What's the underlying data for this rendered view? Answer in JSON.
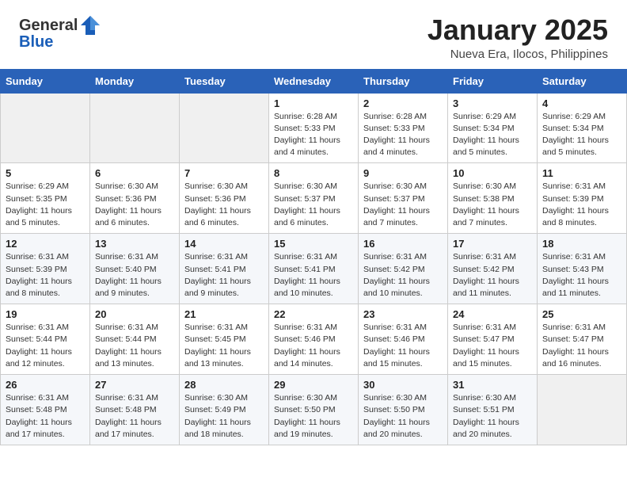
{
  "header": {
    "logo_general": "General",
    "logo_blue": "Blue",
    "month": "January 2025",
    "location": "Nueva Era, Ilocos, Philippines"
  },
  "days_of_week": [
    "Sunday",
    "Monday",
    "Tuesday",
    "Wednesday",
    "Thursday",
    "Friday",
    "Saturday"
  ],
  "weeks": [
    [
      {
        "day": "",
        "info": ""
      },
      {
        "day": "",
        "info": ""
      },
      {
        "day": "",
        "info": ""
      },
      {
        "day": "1",
        "info": "Sunrise: 6:28 AM\nSunset: 5:33 PM\nDaylight: 11 hours\nand 4 minutes."
      },
      {
        "day": "2",
        "info": "Sunrise: 6:28 AM\nSunset: 5:33 PM\nDaylight: 11 hours\nand 4 minutes."
      },
      {
        "day": "3",
        "info": "Sunrise: 6:29 AM\nSunset: 5:34 PM\nDaylight: 11 hours\nand 5 minutes."
      },
      {
        "day": "4",
        "info": "Sunrise: 6:29 AM\nSunset: 5:34 PM\nDaylight: 11 hours\nand 5 minutes."
      }
    ],
    [
      {
        "day": "5",
        "info": "Sunrise: 6:29 AM\nSunset: 5:35 PM\nDaylight: 11 hours\nand 5 minutes."
      },
      {
        "day": "6",
        "info": "Sunrise: 6:30 AM\nSunset: 5:36 PM\nDaylight: 11 hours\nand 6 minutes."
      },
      {
        "day": "7",
        "info": "Sunrise: 6:30 AM\nSunset: 5:36 PM\nDaylight: 11 hours\nand 6 minutes."
      },
      {
        "day": "8",
        "info": "Sunrise: 6:30 AM\nSunset: 5:37 PM\nDaylight: 11 hours\nand 6 minutes."
      },
      {
        "day": "9",
        "info": "Sunrise: 6:30 AM\nSunset: 5:37 PM\nDaylight: 11 hours\nand 7 minutes."
      },
      {
        "day": "10",
        "info": "Sunrise: 6:30 AM\nSunset: 5:38 PM\nDaylight: 11 hours\nand 7 minutes."
      },
      {
        "day": "11",
        "info": "Sunrise: 6:31 AM\nSunset: 5:39 PM\nDaylight: 11 hours\nand 8 minutes."
      }
    ],
    [
      {
        "day": "12",
        "info": "Sunrise: 6:31 AM\nSunset: 5:39 PM\nDaylight: 11 hours\nand 8 minutes."
      },
      {
        "day": "13",
        "info": "Sunrise: 6:31 AM\nSunset: 5:40 PM\nDaylight: 11 hours\nand 9 minutes."
      },
      {
        "day": "14",
        "info": "Sunrise: 6:31 AM\nSunset: 5:41 PM\nDaylight: 11 hours\nand 9 minutes."
      },
      {
        "day": "15",
        "info": "Sunrise: 6:31 AM\nSunset: 5:41 PM\nDaylight: 11 hours\nand 10 minutes."
      },
      {
        "day": "16",
        "info": "Sunrise: 6:31 AM\nSunset: 5:42 PM\nDaylight: 11 hours\nand 10 minutes."
      },
      {
        "day": "17",
        "info": "Sunrise: 6:31 AM\nSunset: 5:42 PM\nDaylight: 11 hours\nand 11 minutes."
      },
      {
        "day": "18",
        "info": "Sunrise: 6:31 AM\nSunset: 5:43 PM\nDaylight: 11 hours\nand 11 minutes."
      }
    ],
    [
      {
        "day": "19",
        "info": "Sunrise: 6:31 AM\nSunset: 5:44 PM\nDaylight: 11 hours\nand 12 minutes."
      },
      {
        "day": "20",
        "info": "Sunrise: 6:31 AM\nSunset: 5:44 PM\nDaylight: 11 hours\nand 13 minutes."
      },
      {
        "day": "21",
        "info": "Sunrise: 6:31 AM\nSunset: 5:45 PM\nDaylight: 11 hours\nand 13 minutes."
      },
      {
        "day": "22",
        "info": "Sunrise: 6:31 AM\nSunset: 5:46 PM\nDaylight: 11 hours\nand 14 minutes."
      },
      {
        "day": "23",
        "info": "Sunrise: 6:31 AM\nSunset: 5:46 PM\nDaylight: 11 hours\nand 15 minutes."
      },
      {
        "day": "24",
        "info": "Sunrise: 6:31 AM\nSunset: 5:47 PM\nDaylight: 11 hours\nand 15 minutes."
      },
      {
        "day": "25",
        "info": "Sunrise: 6:31 AM\nSunset: 5:47 PM\nDaylight: 11 hours\nand 16 minutes."
      }
    ],
    [
      {
        "day": "26",
        "info": "Sunrise: 6:31 AM\nSunset: 5:48 PM\nDaylight: 11 hours\nand 17 minutes."
      },
      {
        "day": "27",
        "info": "Sunrise: 6:31 AM\nSunset: 5:48 PM\nDaylight: 11 hours\nand 17 minutes."
      },
      {
        "day": "28",
        "info": "Sunrise: 6:30 AM\nSunset: 5:49 PM\nDaylight: 11 hours\nand 18 minutes."
      },
      {
        "day": "29",
        "info": "Sunrise: 6:30 AM\nSunset: 5:50 PM\nDaylight: 11 hours\nand 19 minutes."
      },
      {
        "day": "30",
        "info": "Sunrise: 6:30 AM\nSunset: 5:50 PM\nDaylight: 11 hours\nand 20 minutes."
      },
      {
        "day": "31",
        "info": "Sunrise: 6:30 AM\nSunset: 5:51 PM\nDaylight: 11 hours\nand 20 minutes."
      },
      {
        "day": "",
        "info": ""
      }
    ]
  ]
}
